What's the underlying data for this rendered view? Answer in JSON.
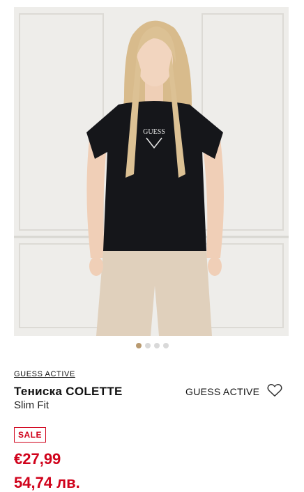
{
  "gallery": {
    "image_alt": "Woman wearing black GUESS T-shirt",
    "shirt_logo_text": "GUESS",
    "dots_total": 4,
    "active_dot": 0
  },
  "product": {
    "brand_link": "GUESS ACTIVE",
    "title": "Тениска COLETTE",
    "fit": "Slim Fit",
    "brand": "GUESS ACTIVE",
    "badge": "SALE",
    "price_eur": "€27,99",
    "price_bgn": "54,74 лв."
  },
  "colors": {
    "sale_red": "#d0021b",
    "active_dot": "#b99a70"
  },
  "icons": {
    "wishlist": "heart-icon"
  }
}
